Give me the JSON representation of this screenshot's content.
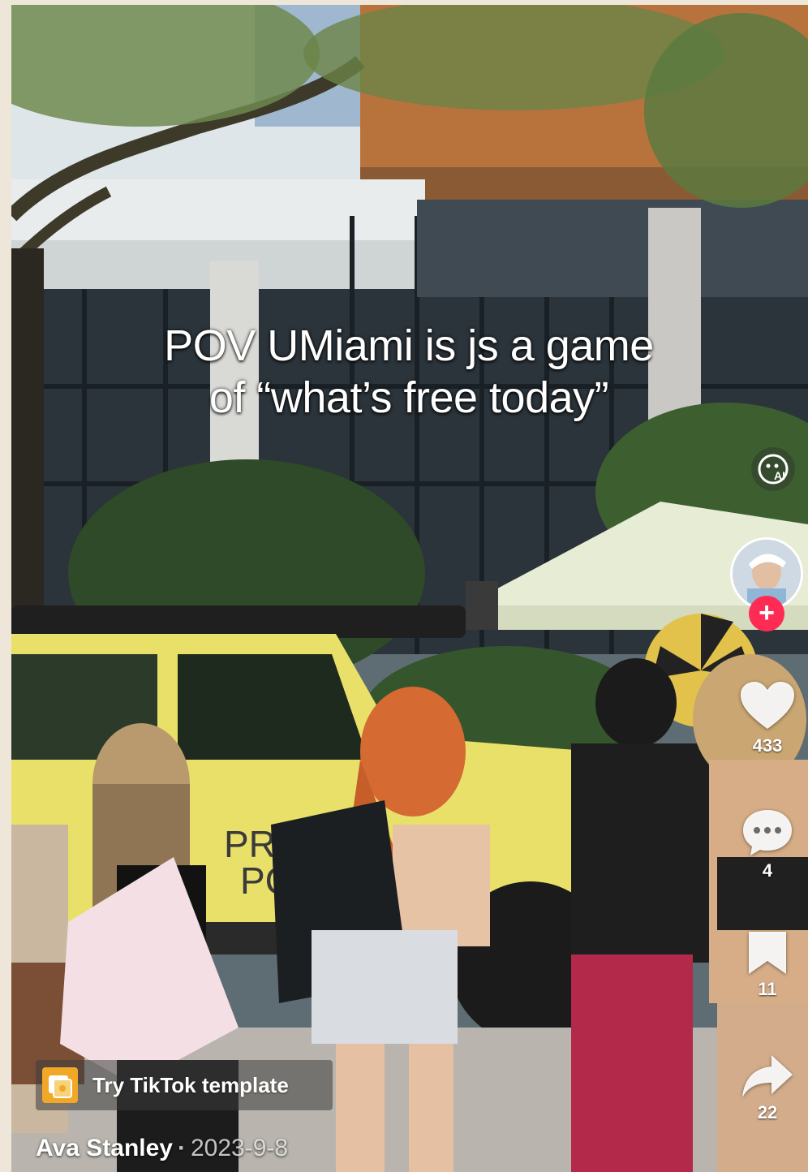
{
  "video": {
    "caption_line1": "POV UMiami is js a game",
    "caption_line2": "of “what’s free today”",
    "sign_text_line1": "PRIN",
    "sign_text_line2": "PC"
  },
  "sidebar": {
    "ai_badge_label": "AI",
    "follow_label": "+",
    "like_count": "433",
    "comment_count": "4",
    "bookmark_count": "11",
    "share_count": "22"
  },
  "template": {
    "label": "Try TikTok template"
  },
  "author": {
    "name": "Ava Stanley",
    "date": "2023-9-8"
  },
  "colors": {
    "follow": "#fe2c55",
    "template_icon": "#f2a827",
    "jeep": "#e9e06a"
  },
  "icons": {
    "ai": "ai-badge-icon",
    "follow": "plus-icon",
    "like": "heart-icon",
    "comment": "comment-icon",
    "bookmark": "bookmark-icon",
    "share": "share-icon",
    "template": "template-icon"
  }
}
